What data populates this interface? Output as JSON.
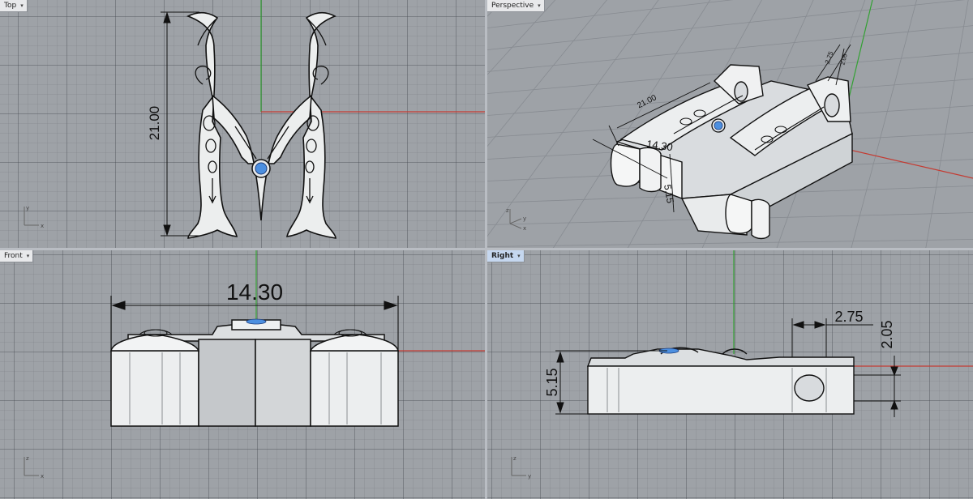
{
  "viewports": {
    "top": {
      "label": "Top",
      "active": false
    },
    "persp": {
      "label": "Perspective",
      "active": false
    },
    "front": {
      "label": "Front",
      "active": false
    },
    "right": {
      "label": "Right",
      "active": true
    }
  },
  "icons": {
    "dropdown": "chevron-down-icon",
    "axis": "axis-triad-icon"
  },
  "axis_labels": {
    "x": "x",
    "y": "y",
    "z": "z"
  },
  "dimensions": {
    "height": "21.00",
    "width": "14.30",
    "thickness": "5.15",
    "hole_offset": "2.75",
    "hole_size": "2.05"
  },
  "colors": {
    "x_axis": "#c43b32",
    "y_axis": "#33a133",
    "viewport_bg": "#9ea2a7",
    "gem": "#4c8fe0",
    "active_label": "#c5d7ef"
  }
}
